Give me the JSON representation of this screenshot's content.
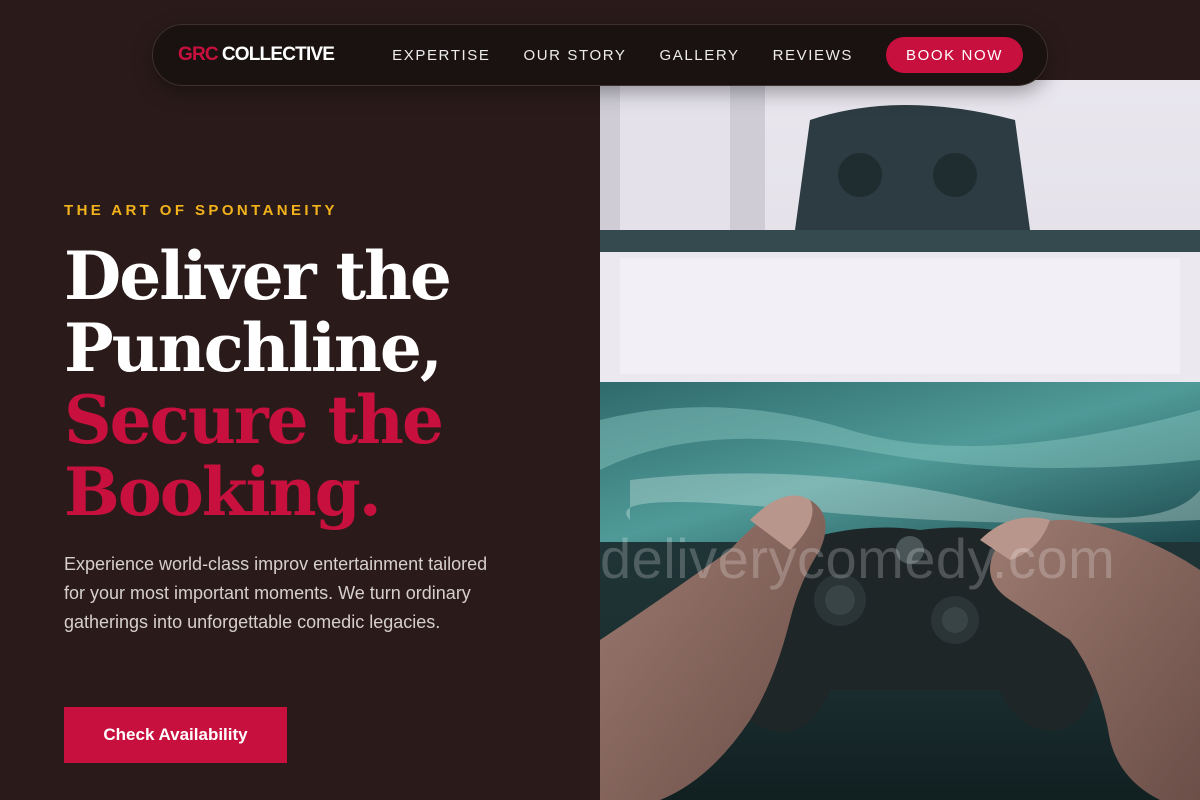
{
  "nav": {
    "logo_accent": "GRC",
    "logo_main": "COLLECTIVE",
    "links": [
      {
        "label": "EXPERTISE"
      },
      {
        "label": "OUR STORY"
      },
      {
        "label": "GALLERY"
      },
      {
        "label": "REVIEWS"
      }
    ],
    "cta_label": "BOOK NOW"
  },
  "hero": {
    "kicker": "THE ART OF SPONTANEITY",
    "headline_line1": "Deliver the",
    "headline_line2": "Punchline,",
    "headline_line3": "Secure the",
    "headline_line4": "Booking.",
    "description": "Experience world-class improv entertainment tailored for your most important moments. We turn ordinary gatherings into unforgettable comedic legacies.",
    "cta_label": "Check Availability",
    "image": {
      "subject": "gamepad-photo",
      "watermark": "deliverycomedy.com"
    }
  },
  "colors": {
    "background": "#2a1b1a",
    "accent": "#c8103e",
    "kicker": "#f2b21c"
  }
}
